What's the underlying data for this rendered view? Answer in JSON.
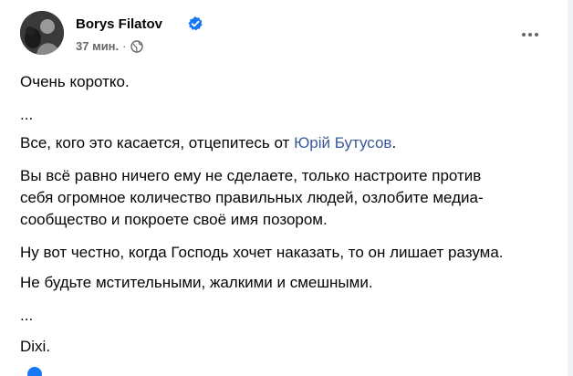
{
  "post": {
    "author": "Borys Filatov",
    "time": "37 мин.",
    "separator": "·",
    "icons": {
      "verified": "verified-badge-icon",
      "privacy": "globe-icon",
      "more": "more-options-icon"
    },
    "accent_color": "#1877f2",
    "mention_color": "#385898",
    "paragraphs": {
      "p1": "Очень коротко.",
      "p2": "...",
      "p3_prefix": "Все, кого это касается, отцепитесь от ",
      "p3_mention": "Юрій Бутусов",
      "p3_suffix": ".",
      "p4_line1": "Вы всё равно ничего ему не сделаете, только настроите против",
      "p4_line2": "себя огромное количество правильных людей, озлобите медиа-",
      "p4_line3": "сообщество и покроете своё имя позором.",
      "p5": "Ну вот честно, когда Господь хочет наказать, то он лишает разума.",
      "p6": "Не будьте мстительными, жалкими и смешными.",
      "p7": "...",
      "p8": "Dixi."
    }
  }
}
